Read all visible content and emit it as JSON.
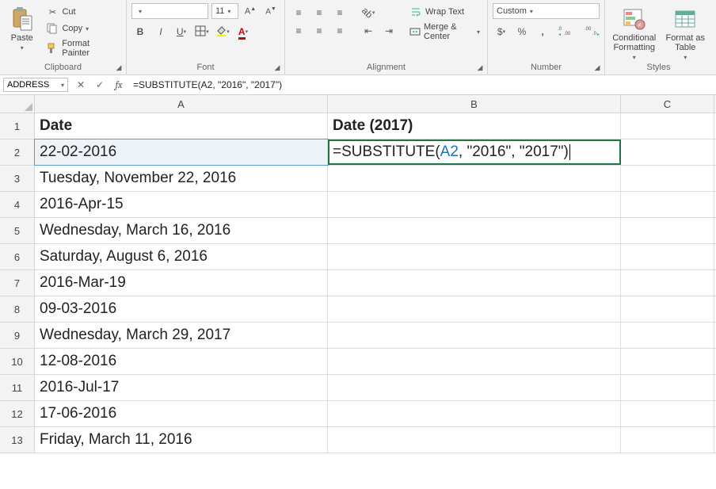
{
  "ribbon": {
    "clipboard": {
      "paste": "Paste",
      "cut": "Cut",
      "copy": "Copy",
      "format_painter": "Format Painter",
      "label": "Clipboard"
    },
    "font": {
      "font_name": "",
      "font_size": "11",
      "label": "Font"
    },
    "alignment": {
      "wrap_text": "Wrap Text",
      "merge_center": "Merge & Center",
      "label": "Alignment"
    },
    "number": {
      "format": "Custom",
      "currency": "$",
      "percent": "%",
      "comma": ",",
      "inc": ".0 .00",
      "dec": ".00 .0",
      "label": "Number"
    },
    "styles": {
      "conditional": "Conditional\nFormatting",
      "format_table": "Format as\nTable",
      "label": "Styles"
    }
  },
  "formula_bar": {
    "name_box": "ADDRESS",
    "text": "=SUBSTITUTE(A2, \"2016\", \"2017\")"
  },
  "columns": {
    "A": "A",
    "B": "B",
    "C": "C"
  },
  "rows": {
    "headers": [
      "1",
      "2",
      "3",
      "4",
      "5",
      "6",
      "7",
      "8",
      "9",
      "10",
      "11",
      "12",
      "13"
    ],
    "header_row": {
      "A": "Date",
      "B": "Date (2017)"
    },
    "data": [
      "22-02-2016",
      "Tuesday, November 22, 2016",
      "2016-Apr-15",
      "Wednesday, March 16, 2016",
      "Saturday, August 6, 2016",
      "2016-Mar-19",
      "09-03-2016",
      "Wednesday, March 29, 2017",
      "12-08-2016",
      "2016-Jul-17",
      "17-06-2016",
      "Friday, March 11, 2016"
    ],
    "b2_prefix": "=SUBSTITUTE(",
    "b2_ref": "A2",
    "b2_suffix": ", \"2016\", \"2017\")"
  }
}
